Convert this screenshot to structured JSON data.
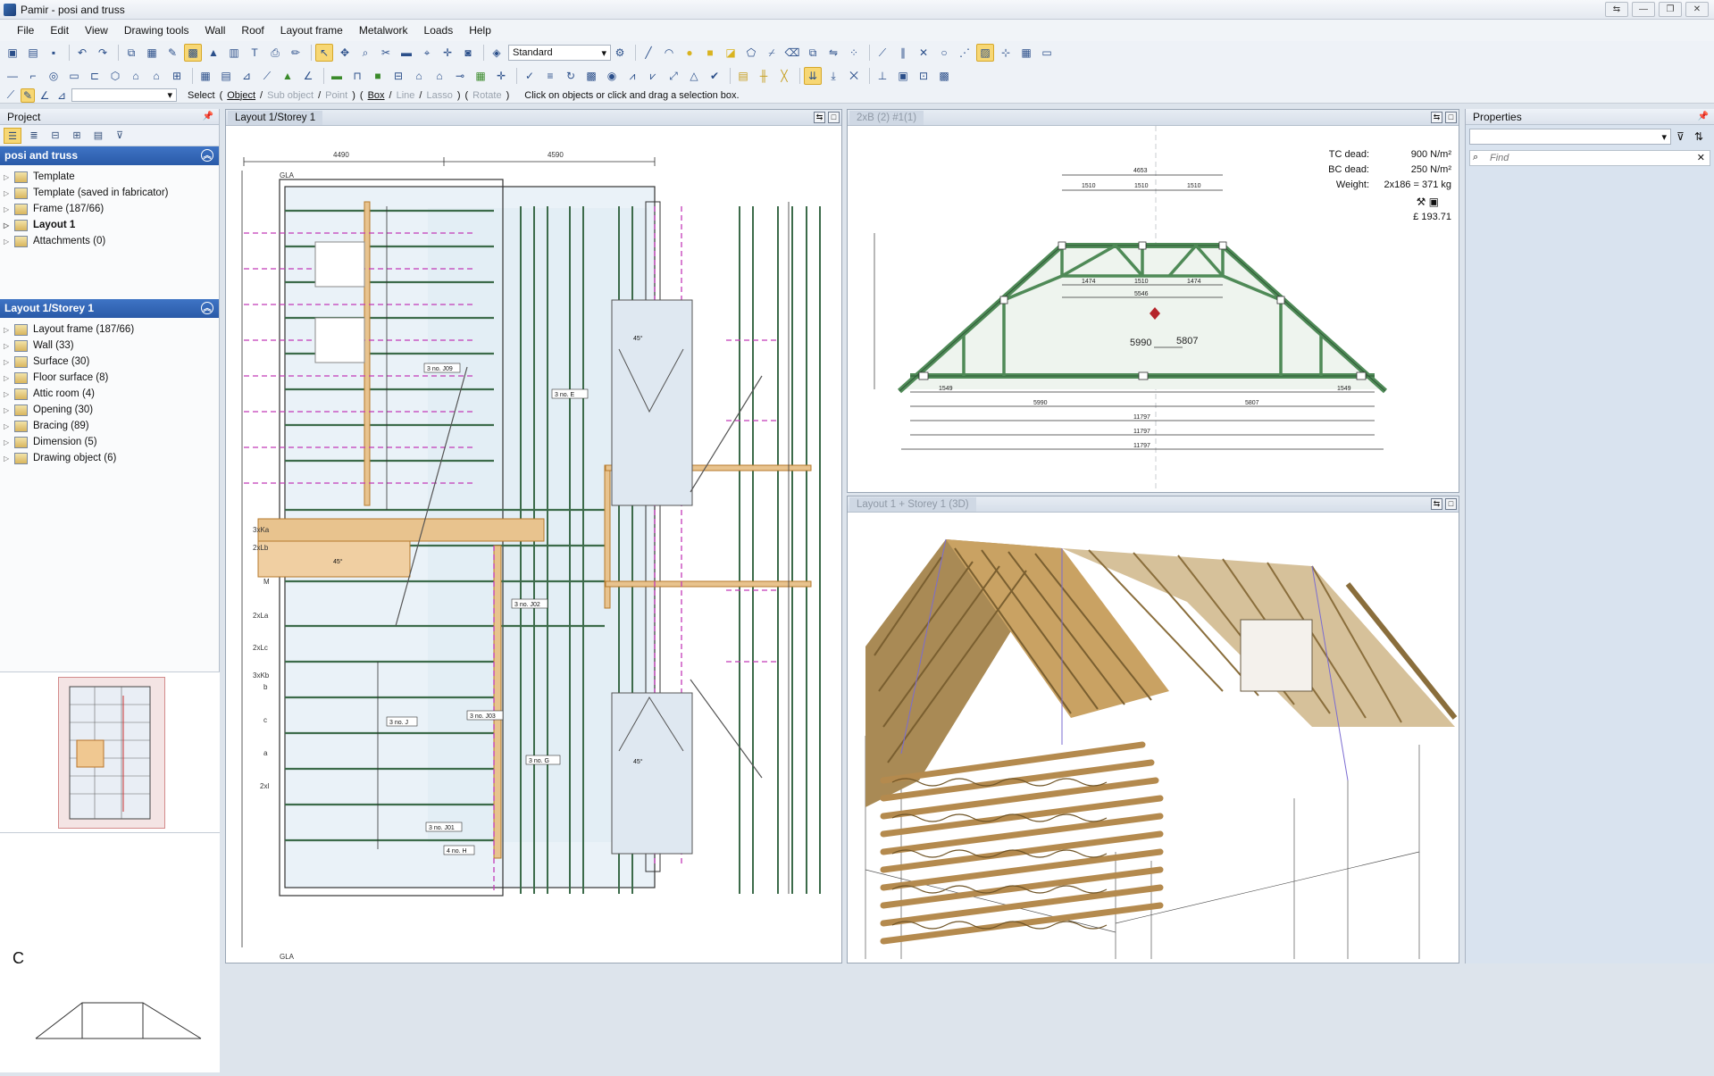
{
  "window": {
    "title": "Pamir - posi and truss"
  },
  "menu": [
    "File",
    "Edit",
    "View",
    "Drawing tools",
    "Wall",
    "Roof",
    "Layout frame",
    "Metalwork",
    "Loads",
    "Help"
  ],
  "toolbar": {
    "style_combo": "Standard"
  },
  "selectbar": {
    "select_label": "Select",
    "items": [
      "(",
      "Object",
      "/",
      "Sub object",
      "/",
      "Point",
      ")",
      "(",
      "Box",
      "/",
      "Line",
      "/",
      "Lasso",
      ")",
      "(",
      "Rotate",
      ")"
    ],
    "hint": "Click on objects or click and drag a selection box."
  },
  "project_panel": {
    "title": "Project",
    "section1": "posi and truss",
    "tree1": [
      {
        "label": "Template",
        "bold": false
      },
      {
        "label": "Template (saved in fabricator)",
        "bold": false
      },
      {
        "label": "Frame (187/66)",
        "bold": false
      },
      {
        "label": "Layout  1",
        "bold": true
      },
      {
        "label": "Attachments (0)",
        "bold": false
      }
    ],
    "section2": "Layout  1/Storey  1",
    "tree2": [
      {
        "label": "Layout frame (187/66)"
      },
      {
        "label": "Wall (33)"
      },
      {
        "label": "Surface (30)"
      },
      {
        "label": "Floor surface (8)"
      },
      {
        "label": "Attic room (4)"
      },
      {
        "label": "Opening (30)"
      },
      {
        "label": "Bracing (89)"
      },
      {
        "label": "Dimension (5)"
      },
      {
        "label": "Drawing object (6)"
      }
    ],
    "thumb_label": "C"
  },
  "plan_view": {
    "tab": "Layout 1/Storey 1",
    "labels": {
      "top_dims": [
        "4490",
        "4590"
      ],
      "gla": "GLA",
      "rows": [
        "3xKa",
        "2xLb",
        "M",
        "2xLa",
        "2xLc",
        "3xKb",
        "b",
        "c",
        "a",
        "2xl"
      ],
      "joists": [
        "3 no. J09",
        "3 no. E",
        "3 no. J02",
        "3 no. J03",
        "3 no. J",
        "3 no. G",
        "3 no. J01",
        "4 no. H"
      ],
      "angle": "45°"
    }
  },
  "truss_view": {
    "tab": "2xB (2) #1(1)",
    "tc_label": "TC dead:",
    "tc_value": "900 N/m²",
    "bc_label": "BC dead:",
    "bc_value": "250 N/m²",
    "weight_label": "Weight:",
    "weight_value": "2x186 = 371 kg",
    "price": "£ 193.71",
    "dims": {
      "top": "4653",
      "seg": [
        "1510",
        "1510",
        "1510"
      ],
      "inner": [
        "1474",
        "1510",
        "1474"
      ],
      "span": "5546",
      "base": [
        "5990",
        "5807"
      ],
      "total": "11797",
      "left": "1549",
      "right": "1549"
    }
  },
  "view3d": {
    "tab": "Layout 1 + Storey 1 (3D)"
  },
  "properties_panel": {
    "title": "Properties",
    "search_placeholder": "Find"
  }
}
